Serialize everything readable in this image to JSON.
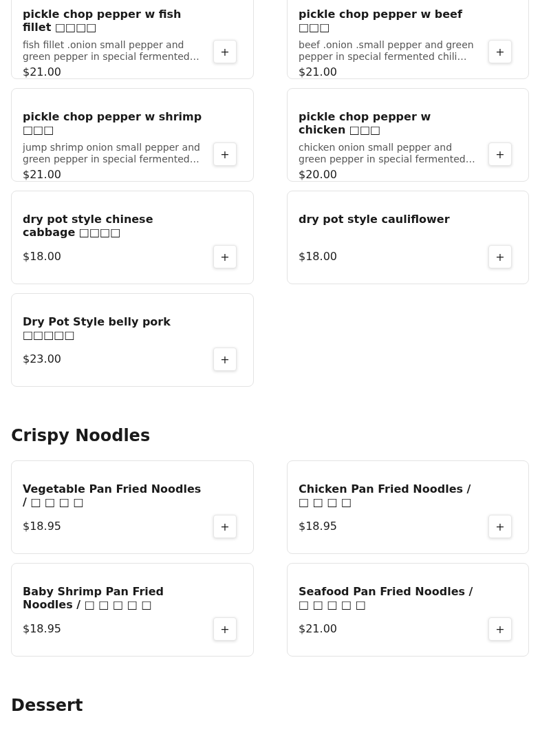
{
  "sections": [
    {
      "items": [
        {
          "title": "pickle chop pepper w fish fillet □□□□",
          "description": "fish fillet .onion small pepper and green pepper in special fermented…",
          "price": "$21.00",
          "button": "+"
        },
        {
          "title": "pickle chop pepper w beef □□□",
          "description": "beef .onion .small pepper and green pepper in special fermented chili…",
          "price": "$21.00",
          "button": "+"
        },
        {
          "title": "pickle chop pepper w shrimp □□□",
          "description": "jump shrimp onion small pepper and green pepper in special fermented…",
          "price": "$21.00",
          "button": "+"
        },
        {
          "title": "pickle chop pepper w chicken □□□",
          "description": "chicken onion small pepper and green pepper in special fermented…",
          "price": "$20.00",
          "button": "+"
        },
        {
          "title": "dry pot style chinese cabbage □□□□",
          "price": "$18.00",
          "button": "+"
        },
        {
          "title": "dry pot style cauliflower",
          "price": "$18.00",
          "button": "+"
        },
        {
          "title": "Dry Pot Style belly pork □□□□□",
          "price": "$23.00",
          "button": "+"
        }
      ]
    },
    {
      "heading": "Crispy Noodles",
      "items": [
        {
          "title": "Vegetable Pan Fried Noodles / □ □ □ □",
          "price": "$18.95",
          "button": "+"
        },
        {
          "title": "Chicken Pan Fried Noodles / □ □ □ □",
          "price": "$18.95",
          "button": "+"
        },
        {
          "title": "Baby Shrimp Pan Fried Noodles / □ □ □ □ □",
          "price": "$18.95",
          "button": "+"
        },
        {
          "title": "Seafood Pan Fried Noodles / □ □ □ □ □",
          "price": "$21.00",
          "button": "+"
        }
      ]
    },
    {
      "heading": "Dessert"
    }
  ]
}
